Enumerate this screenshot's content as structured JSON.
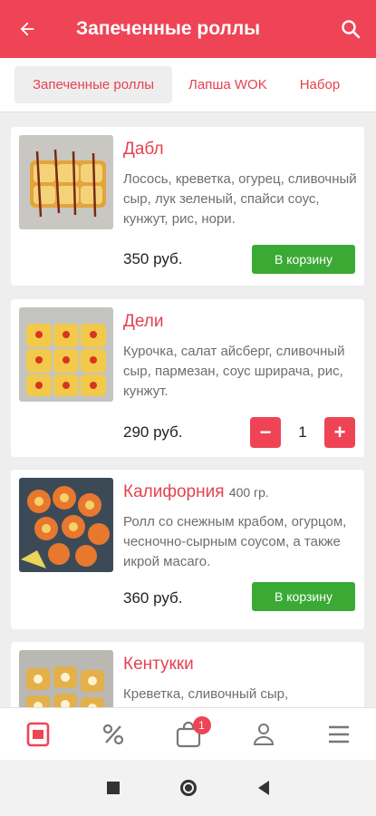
{
  "header": {
    "title": "Запеченные роллы",
    "back_icon": "arrow-left-icon",
    "search_icon": "search-icon"
  },
  "tabs": [
    "Запеченные роллы",
    "Лапша WOK",
    "Набор"
  ],
  "products": [
    {
      "name": "Дабл",
      "weight": "",
      "description": "Лосось, креветка, огурец, сливочный сыр, лук зеленый, спайси соус, кунжут, рис, нори.",
      "price": "350 руб.",
      "button": "В корзину"
    },
    {
      "name": "Дели",
      "weight": "",
      "description": "Курочка, салат айсберг, сливочный сыр, пармезан, соус шрирача, рис, кунжут.",
      "price": "290 руб.",
      "quantity": "1",
      "minus": "−",
      "plus": "+"
    },
    {
      "name": "Калифорния",
      "weight": "400 гр.",
      "description": "Ролл со снежным крабом, огурцом, чесночно-сырным соусом, а также икрой масаго.",
      "price": "360 руб.",
      "button": "В корзину"
    },
    {
      "name": "Кентукки",
      "weight": "",
      "description": "Креветка, сливочный сыр,",
      "price": ""
    }
  ],
  "bottom_nav": {
    "items": [
      "menu-icon",
      "percent-icon",
      "cart-icon",
      "profile-icon",
      "hamburger-icon"
    ],
    "cart_badge": "1"
  },
  "colors": {
    "primary": "#ef4456",
    "accent_text": "#e5424f",
    "green": "#3aaa35"
  }
}
